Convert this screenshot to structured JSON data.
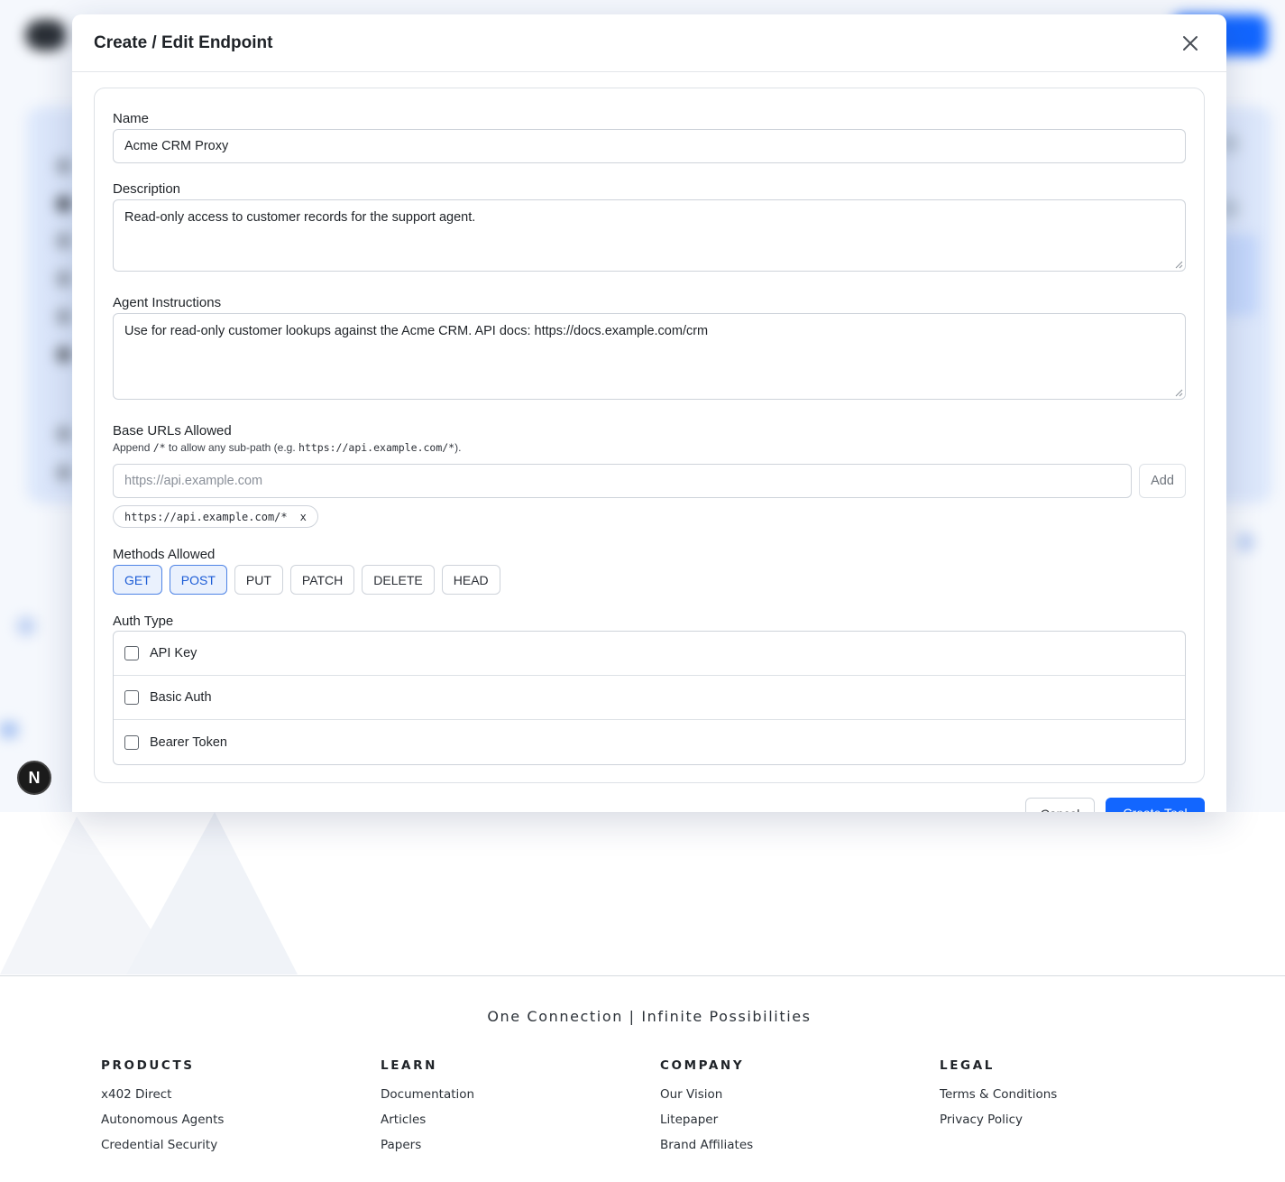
{
  "modal": {
    "title": "Create / Edit Endpoint",
    "footer": {
      "cancel_label": "Cancel",
      "create_label": "Create Tool"
    }
  },
  "form": {
    "name": {
      "label": "Name",
      "value": "Acme CRM Proxy"
    },
    "description": {
      "label": "Description",
      "value": "Read-only access to customer records for the support agent."
    },
    "instructions": {
      "label": "Agent Instructions",
      "value": "Use for read-only customer lookups against the Acme CRM. API docs: https://docs.example.com/crm"
    },
    "base_urls": {
      "label": "Base URLs Allowed",
      "hint_prefix": "Append",
      "hint_code1": "/*",
      "hint_middle": "to allow any sub-path (e.g.",
      "hint_code2": "https://api.example.com/*",
      "hint_suffix": ").",
      "placeholder": "https://api.example.com",
      "add_label": "Add",
      "chips": [
        {
          "url": "https://api.example.com/*",
          "remove": "x"
        }
      ]
    },
    "methods": {
      "label": "Methods Allowed",
      "items": [
        {
          "label": "GET",
          "selected": true
        },
        {
          "label": "POST",
          "selected": true
        },
        {
          "label": "PUT",
          "selected": false
        },
        {
          "label": "PATCH",
          "selected": false
        },
        {
          "label": "DELETE",
          "selected": false
        },
        {
          "label": "HEAD",
          "selected": false
        }
      ]
    },
    "auth": {
      "label": "Auth Type",
      "options": [
        {
          "label": "API Key",
          "checked": false
        },
        {
          "label": "Basic Auth",
          "checked": false
        },
        {
          "label": "Bearer Token",
          "checked": false
        }
      ]
    }
  },
  "badge": {
    "letter": "N"
  },
  "footer": {
    "tagline": "One Connection | Infinite Possibilities",
    "columns": [
      {
        "heading": "PRODUCTS",
        "links": [
          "x402 Direct",
          "Autonomous Agents",
          "Credential Security"
        ]
      },
      {
        "heading": "LEARN",
        "links": [
          "Documentation",
          "Articles",
          "Papers"
        ]
      },
      {
        "heading": "COMPANY",
        "links": [
          "Our Vision",
          "Litepaper",
          "Brand Affiliates"
        ]
      },
      {
        "heading": "LEGAL",
        "links": [
          "Terms & Conditions",
          "Privacy Policy"
        ]
      }
    ]
  },
  "colors": {
    "primary": "#1266ff",
    "selected_bg": "#eaf1fd",
    "selected_border": "#4f84e6",
    "text": "#1f2328"
  },
  "icons": {
    "close": "close-icon",
    "badge": "nextjs-badge-icon"
  }
}
